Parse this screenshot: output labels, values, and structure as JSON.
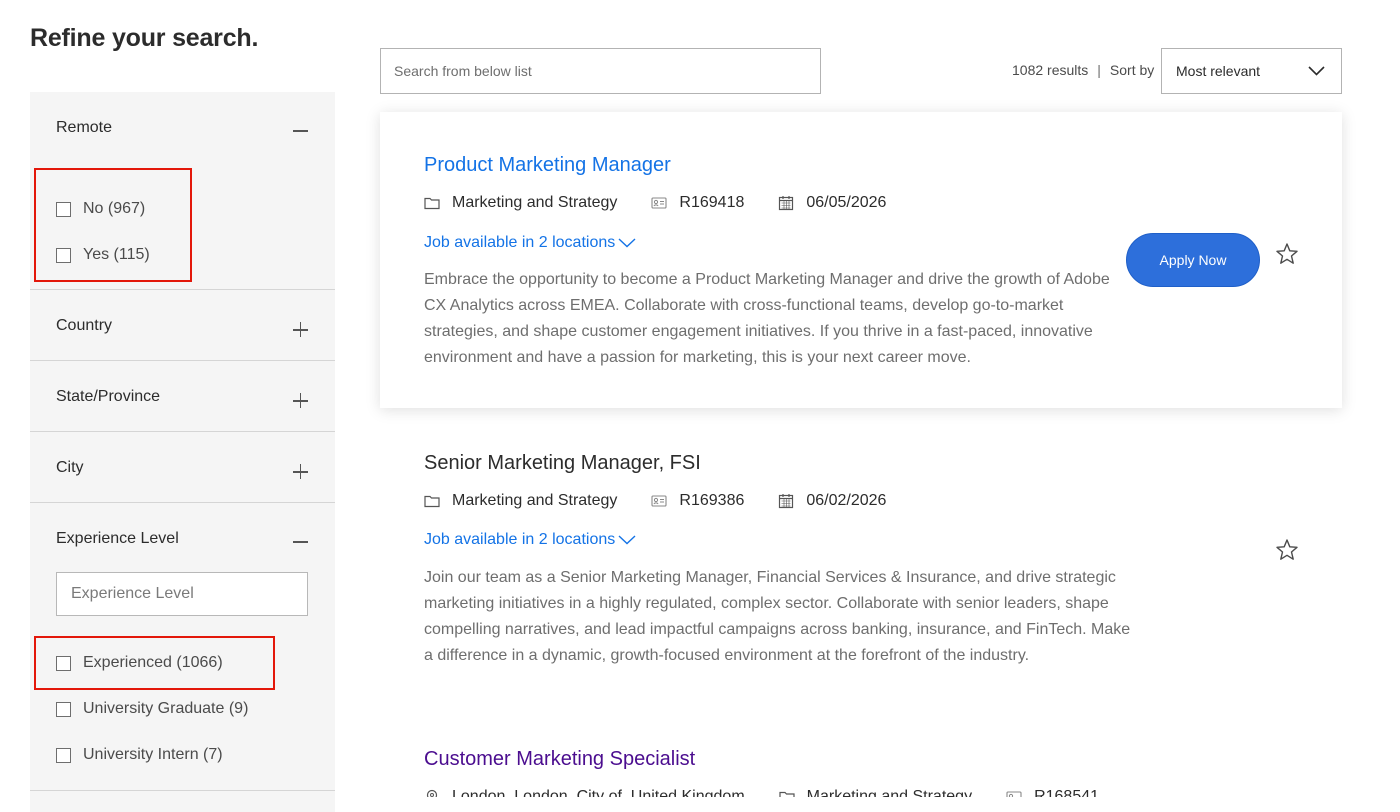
{
  "page": {
    "heading": "Refine your search."
  },
  "sidebar": {
    "facets": {
      "remote": {
        "title": "Remote",
        "options": [
          {
            "label": "No (967)"
          },
          {
            "label": "Yes (115)"
          }
        ]
      },
      "country": {
        "title": "Country"
      },
      "state": {
        "title": "State/Province"
      },
      "city": {
        "title": "City"
      },
      "experience": {
        "title": "Experience Level",
        "search_placeholder": "Experience Level",
        "options": [
          {
            "label": "Experienced (1066)"
          },
          {
            "label": "University Graduate (9)"
          },
          {
            "label": "University Intern (7)"
          }
        ]
      }
    }
  },
  "toolbar": {
    "search_placeholder": "Search from below list",
    "results_count": "1082 results",
    "sort_label": "Sort by",
    "sort_value": "Most relevant"
  },
  "jobs": [
    {
      "title": "Product Marketing Manager",
      "category": "Marketing and Strategy",
      "req_id": "R169418",
      "date": "06/05/2026",
      "locations_link": "Job available in 2 locations",
      "description": "Embrace the opportunity to become a Product Marketing Manager and drive the growth of Adobe CX Analytics across EMEA. Collaborate with cross-functional teams, develop go-to-market strategies, and shape customer engagement initiatives. If you thrive in a fast-paced, innovative environment and have a passion for marketing, this is your next career move.",
      "apply_label": "Apply Now"
    },
    {
      "title": "Senior Marketing Manager, FSI",
      "category": "Marketing and Strategy",
      "req_id": "R169386",
      "date": "06/02/2026",
      "locations_link": "Job available in 2 locations",
      "description": "Join our team as a Senior Marketing Manager, Financial Services & Insurance, and drive strategic marketing initiatives in a highly regulated, complex sector. Collaborate with senior leaders, shape compelling narratives, and lead impactful campaigns across banking, insurance, and FinTech. Make a difference in a dynamic, growth-focused environment at the forefront of the industry."
    },
    {
      "title": "Customer Marketing Specialist",
      "location": "London, London, City of, United Kingdom",
      "category": "Marketing and Strategy",
      "req_id": "R168541"
    }
  ],
  "colors": {
    "link_blue": "#1473e6",
    "visited_purple": "#4b0d8f",
    "apply_button": "#2d6fdb",
    "highlight_red": "#e3170a",
    "sidebar_bg": "#f5f5f5"
  },
  "icons": [
    "folder-icon",
    "id-badge-icon",
    "calendar-icon",
    "chevron-down-icon",
    "star-icon",
    "location-pin-icon",
    "minus-icon",
    "plus-icon",
    "checkbox-icon"
  ]
}
